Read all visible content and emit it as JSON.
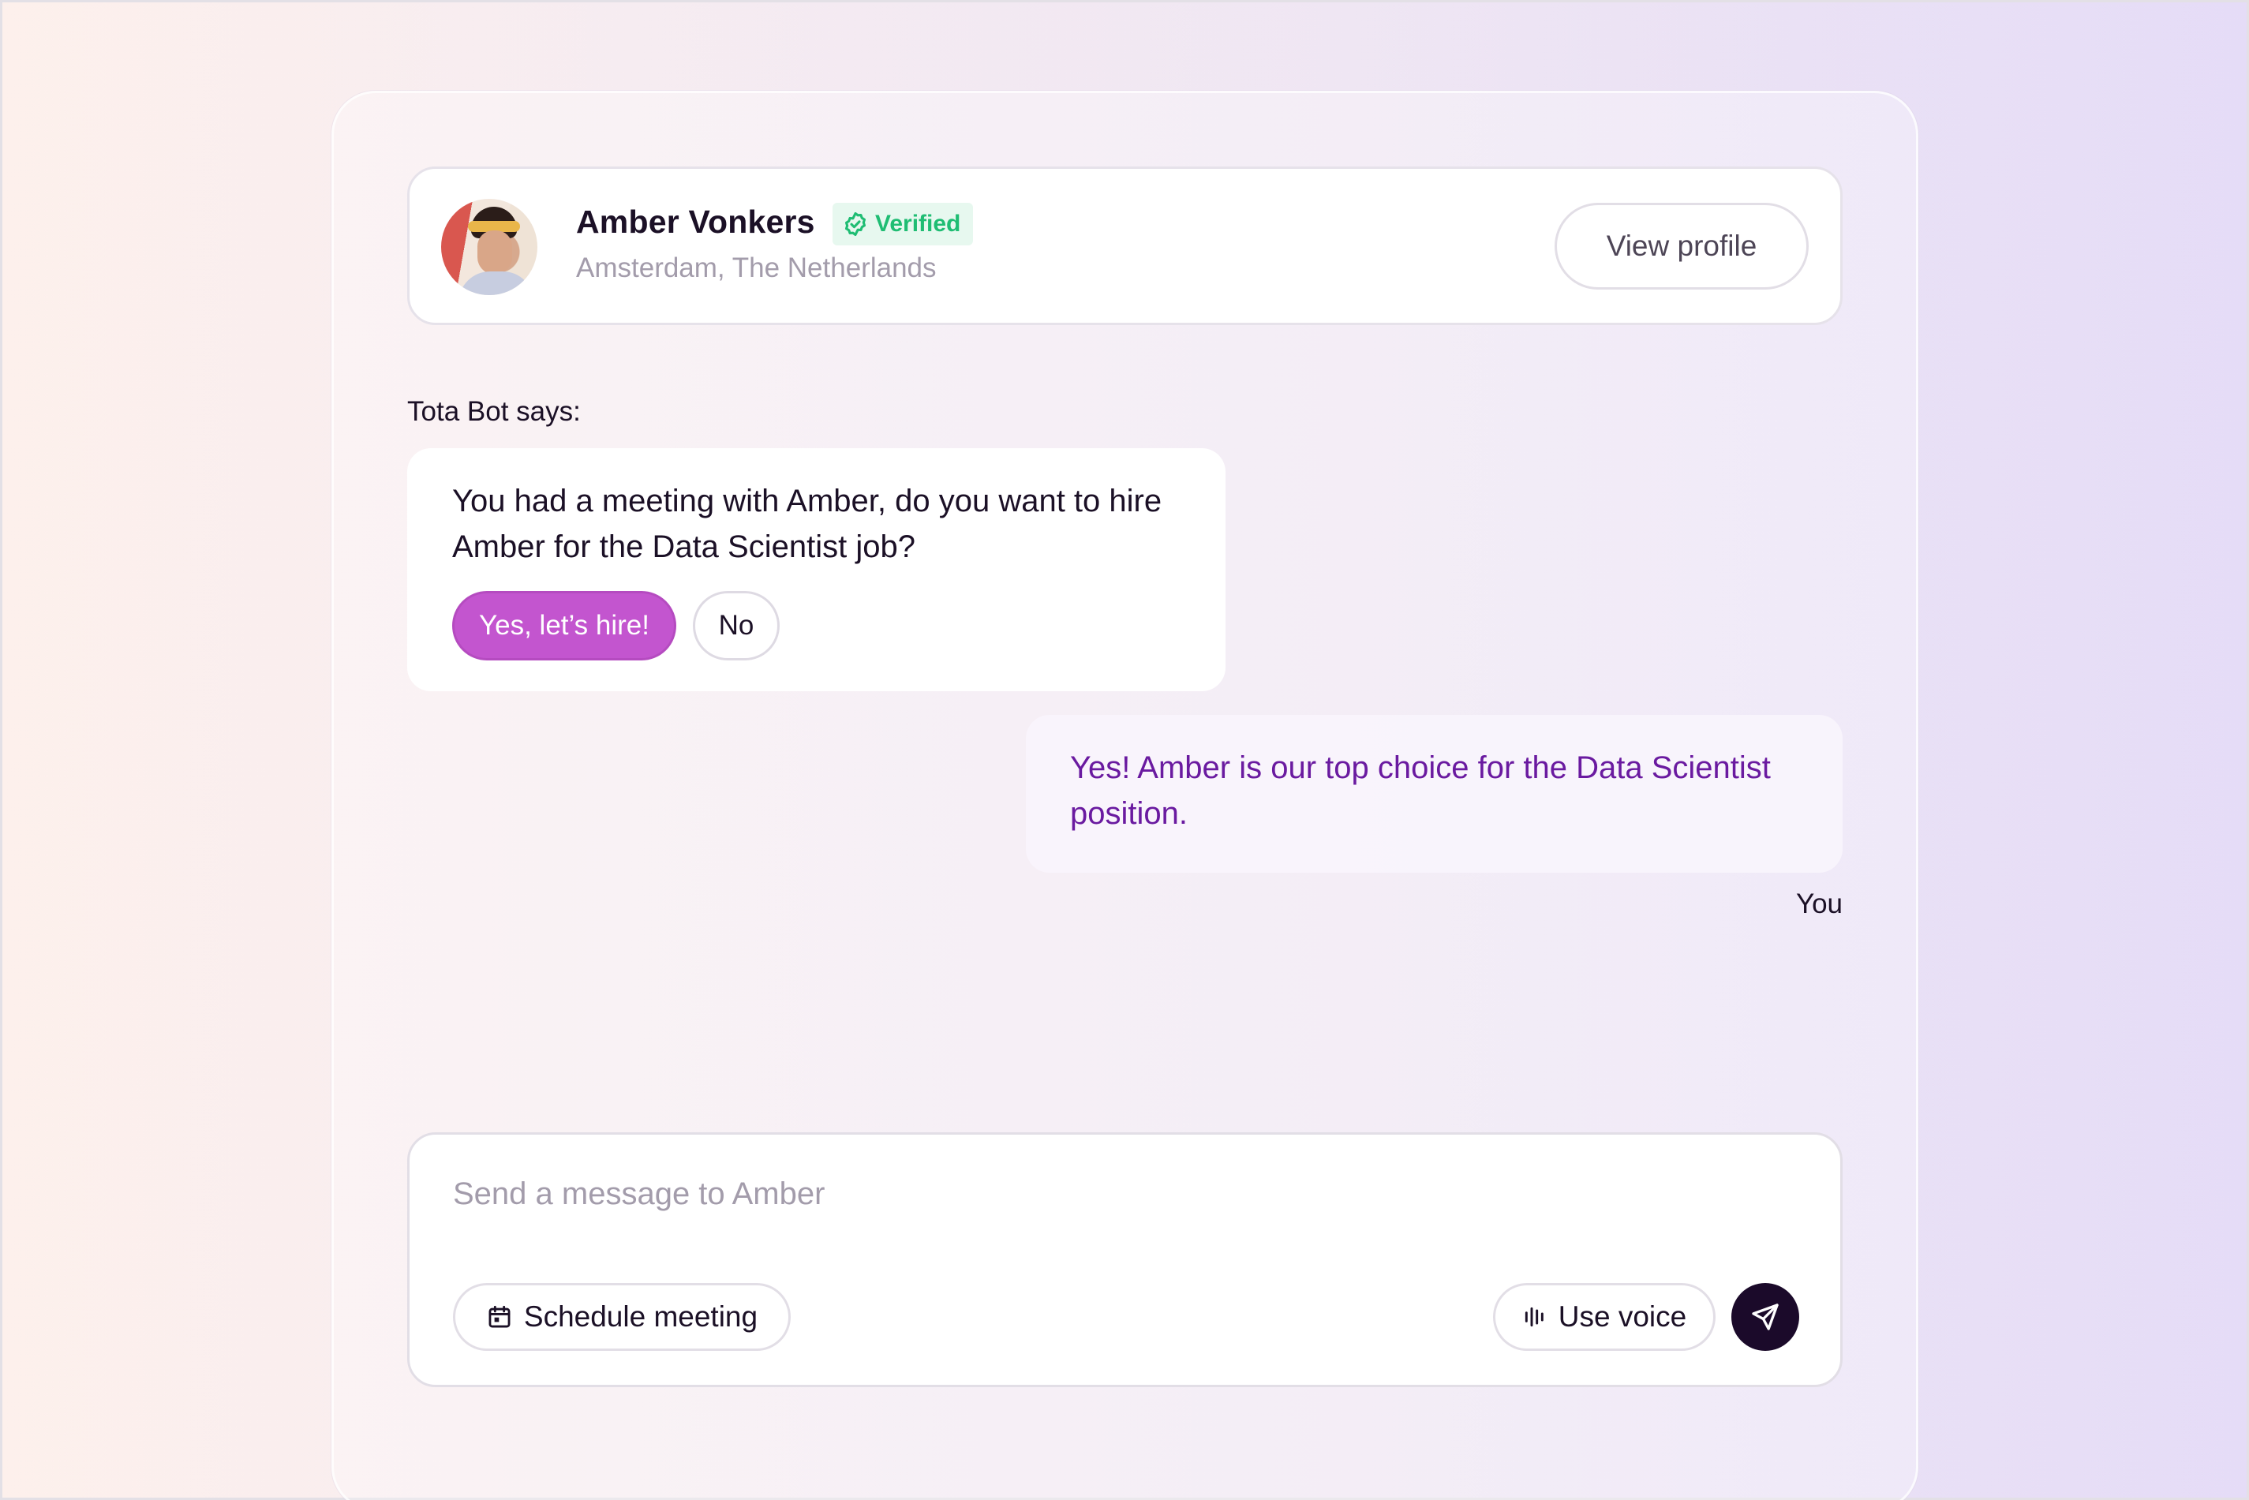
{
  "profile": {
    "name": "Amber Vonkers",
    "badge": "Verified",
    "location": "Amsterdam, The Netherlands",
    "view_profile_label": "View profile",
    "avatar_icon": "avatar-photo"
  },
  "conversation": {
    "bot_label": "Tota Bot says:",
    "bot_message": "You had a meeting with Amber, do you want to hire Amber for the Data Scientist job?",
    "yes_label": "Yes, let’s hire!",
    "no_label": "No",
    "user_message": "Yes! Amber is our top choice for the Data Scientist position.",
    "user_label": "You"
  },
  "composer": {
    "placeholder": "Send a message to Amber",
    "value": "",
    "schedule_label": "Schedule meeting",
    "voice_label": "Use voice",
    "schedule_icon": "calendar-icon",
    "voice_icon": "waveform-icon",
    "send_icon": "send-icon"
  },
  "colors": {
    "accent": "#c355cf",
    "user_text": "#6a1aa0",
    "verified": "#1fbd73",
    "send_button": "#1b0a2a"
  }
}
